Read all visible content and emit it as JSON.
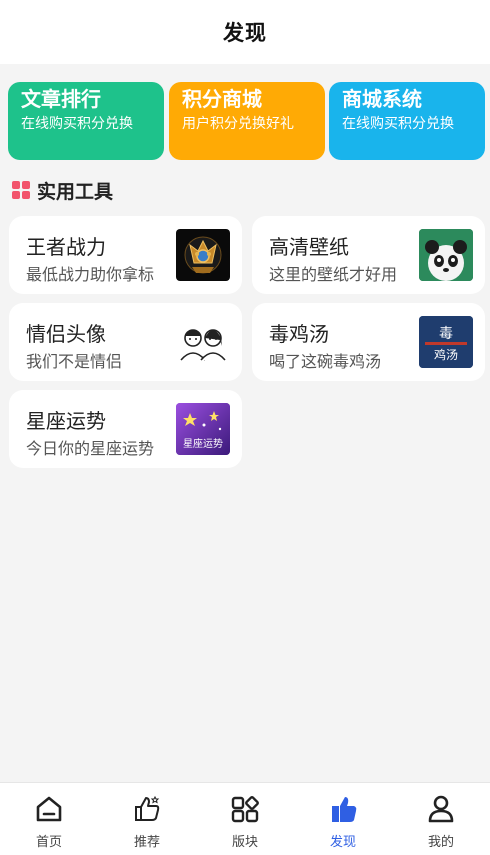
{
  "header": {
    "title": "发现"
  },
  "banners": [
    {
      "title": "文章排行",
      "desc": "在线购买积分兑换",
      "color": "#1ec28b"
    },
    {
      "title": "积分商城",
      "desc": "用户积分兑换好礼",
      "color": "#ffaa05"
    },
    {
      "title": "商城系统",
      "desc": "在线购买积分兑换",
      "color": "#19b4ec"
    }
  ],
  "section": {
    "title": "实用工具",
    "icon": "grid-icon",
    "icon_color": "#f2546c"
  },
  "tools": [
    {
      "title": "王者战力",
      "subtitle": "最低战力助你拿标",
      "icon": "king-glory-badge-icon"
    },
    {
      "title": "高清壁纸",
      "subtitle": "这里的壁纸才好用",
      "icon": "panda-wallpaper-icon"
    },
    {
      "title": "情侣头像",
      "subtitle": "我们不是情侣",
      "icon": "couple-avatar-icon"
    },
    {
      "title": "毒鸡汤",
      "subtitle": "喝了这碗毒鸡汤",
      "icon": "poison-soup-icon",
      "icon_text_top": "毒",
      "icon_text_bottom": "鸡汤"
    },
    {
      "title": "星座运势",
      "subtitle": "今日你的星座运势",
      "icon": "horoscope-icon",
      "icon_text": "星座运势"
    }
  ],
  "tabbar": {
    "accent": "#2f5fe3",
    "items": [
      {
        "label": "首页",
        "icon": "home-icon"
      },
      {
        "label": "推荐",
        "icon": "thumbs-up-icon"
      },
      {
        "label": "版块",
        "icon": "blocks-icon"
      },
      {
        "label": "发现",
        "icon": "discover-icon",
        "active": true
      },
      {
        "label": "我的",
        "icon": "user-icon"
      }
    ]
  }
}
